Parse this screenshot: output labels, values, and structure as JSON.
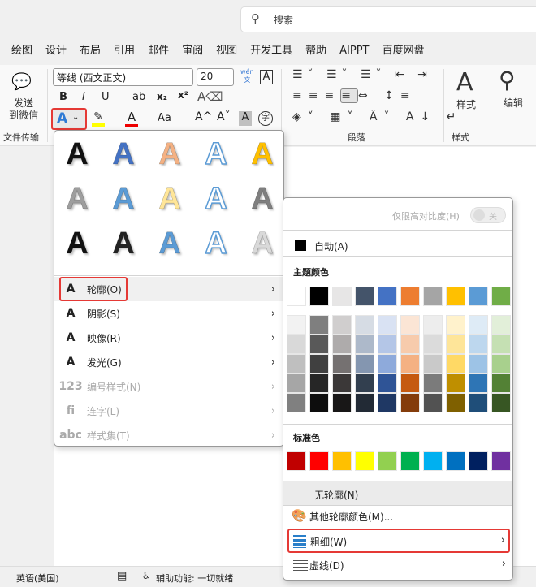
{
  "search": {
    "icon": "search-icon",
    "placeholder": "搜索"
  },
  "tabs": [
    "绘图",
    "设计",
    "布局",
    "引用",
    "邮件",
    "审阅",
    "视图",
    "开发工具",
    "帮助",
    "AIPPT",
    "百度网盘"
  ],
  "ribbon": {
    "send_wechat": "发送\n到微信",
    "group_file": "文件传输",
    "font_name": "等线 (西文正文)",
    "font_size": "20",
    "phonetic_top": "wén",
    "phonetic_bottom": "文",
    "char_border": "A",
    "bold": "B",
    "italic": "I",
    "underline": "U",
    "strike": "ab",
    "subscript": "x₂",
    "superscript": "x²",
    "text_effect": "A",
    "font_color": "A",
    "case": "Aa",
    "grow": "A^",
    "shrink": "Aˇ",
    "shading": "A",
    "enclose": "字",
    "group_paragraph": "段落",
    "styles_label": "样式",
    "group_styles": "样式",
    "editing_label": "编辑"
  },
  "effects_menu": {
    "gallery_glyph": "A",
    "gallery_colors": [
      "#111111",
      "#4472c4",
      "#f4b183",
      "#ffffff",
      "#ffc000",
      "#9e9e9e",
      "#5b9bd5",
      "#ffe699",
      "#ffffff",
      "#7f7f7f",
      "#111111",
      "#222222",
      "#5b9bd5",
      "#ffffff",
      "#d9d9d9"
    ],
    "items": [
      {
        "label": "轮廓(O)",
        "icon": "A",
        "disabled": false
      },
      {
        "label": "阴影(S)",
        "icon": "A",
        "disabled": false
      },
      {
        "label": "映像(R)",
        "icon": "A",
        "disabled": false
      },
      {
        "label": "发光(G)",
        "icon": "A",
        "disabled": false
      },
      {
        "label": "编号样式(N)",
        "icon": "123",
        "disabled": true
      },
      {
        "label": "连字(L)",
        "icon": "fi",
        "disabled": true
      },
      {
        "label": "样式集(T)",
        "icon": "abc",
        "disabled": true
      }
    ]
  },
  "outline_menu": {
    "high_contrast": "仅限高对比度(H)",
    "toggle_state": "关",
    "automatic": "自动(A)",
    "theme_title": "主题颜色",
    "theme_colors": [
      "#ffffff",
      "#000000",
      "#e7e6e6",
      "#44546a",
      "#4472c4",
      "#ed7d31",
      "#a5a5a5",
      "#ffc000",
      "#5b9bd5",
      "#70ad47"
    ],
    "tints": [
      [
        "#f2f2f2",
        "#d9d9d9",
        "#bfbfbf",
        "#a6a6a6",
        "#808080"
      ],
      [
        "#7f7f7f",
        "#595959",
        "#404040",
        "#262626",
        "#0d0d0d"
      ],
      [
        "#d0cece",
        "#aeabab",
        "#757171",
        "#3b3838",
        "#181717"
      ],
      [
        "#d6dce4",
        "#adb9ca",
        "#8496b0",
        "#323f4f",
        "#222a35"
      ],
      [
        "#d9e2f3",
        "#b4c6e7",
        "#8eaadb",
        "#2f5496",
        "#1f3864"
      ],
      [
        "#fbe5d5",
        "#f7cbac",
        "#f4b183",
        "#c55a11",
        "#843c0b"
      ],
      [
        "#ededed",
        "#dbdbdb",
        "#c9c9c9",
        "#7b7b7b",
        "#525252"
      ],
      [
        "#fff2cc",
        "#fee599",
        "#ffd965",
        "#bf8f00",
        "#7f6000"
      ],
      [
        "#deebf6",
        "#bdd7ee",
        "#9dc3e6",
        "#2e75b5",
        "#1f4e79"
      ],
      [
        "#e2efd9",
        "#c5e0b3",
        "#a8d08d",
        "#538135",
        "#375623"
      ]
    ],
    "standard_title": "标准色",
    "standard_colors": [
      "#c00000",
      "#ff0000",
      "#ffc000",
      "#ffff00",
      "#92d050",
      "#00b050",
      "#00b0f0",
      "#0070c0",
      "#002060",
      "#7030a0"
    ],
    "no_outline": "无轮廓(N)",
    "more_colors": "其他轮廓颜色(M)...",
    "weight": "粗细(W)",
    "dashes": "虚线(D)"
  },
  "status": {
    "language": "英语(美国)",
    "accessibility": "辅助功能: 一切就绪"
  }
}
